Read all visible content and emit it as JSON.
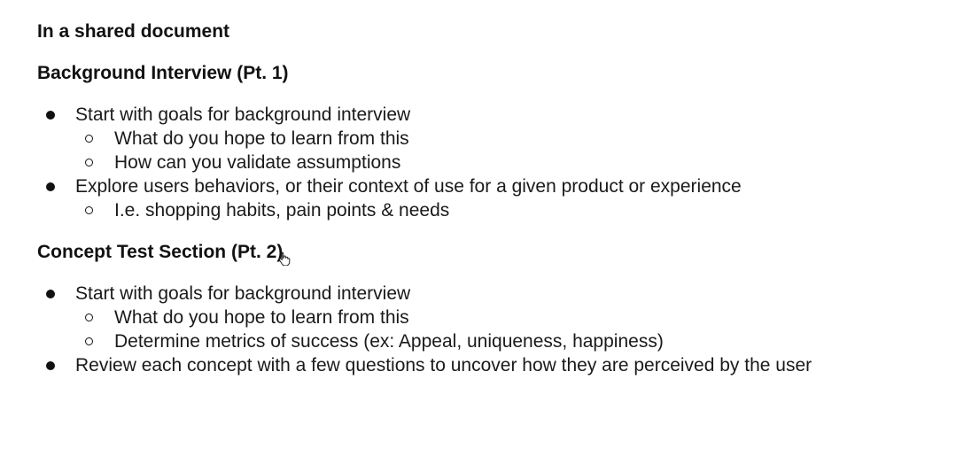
{
  "document": {
    "title": "In a shared document",
    "sections": [
      {
        "heading": "Background Interview (Pt. 1)",
        "items": [
          {
            "text": "Start with goals for background interview",
            "subitems": [
              "What do you hope to learn from this",
              "How can you validate assumptions"
            ]
          },
          {
            "text": "Explore users behaviors, or their context of use for a given product or experience",
            "subitems": [
              "I.e. shopping habits, pain points & needs"
            ]
          }
        ]
      },
      {
        "heading": "Concept Test Section (Pt. 2)",
        "items": [
          {
            "text": "Start with goals for background interview",
            "subitems": [
              "What do you hope to learn from this",
              "Determine metrics of success (ex: Appeal, uniqueness, happiness)"
            ]
          },
          {
            "text": "Review each concept with a few questions to uncover how they are perceived by the user",
            "subitems": []
          }
        ]
      }
    ]
  },
  "cursor": {
    "icon": "hand-pointer-icon"
  }
}
